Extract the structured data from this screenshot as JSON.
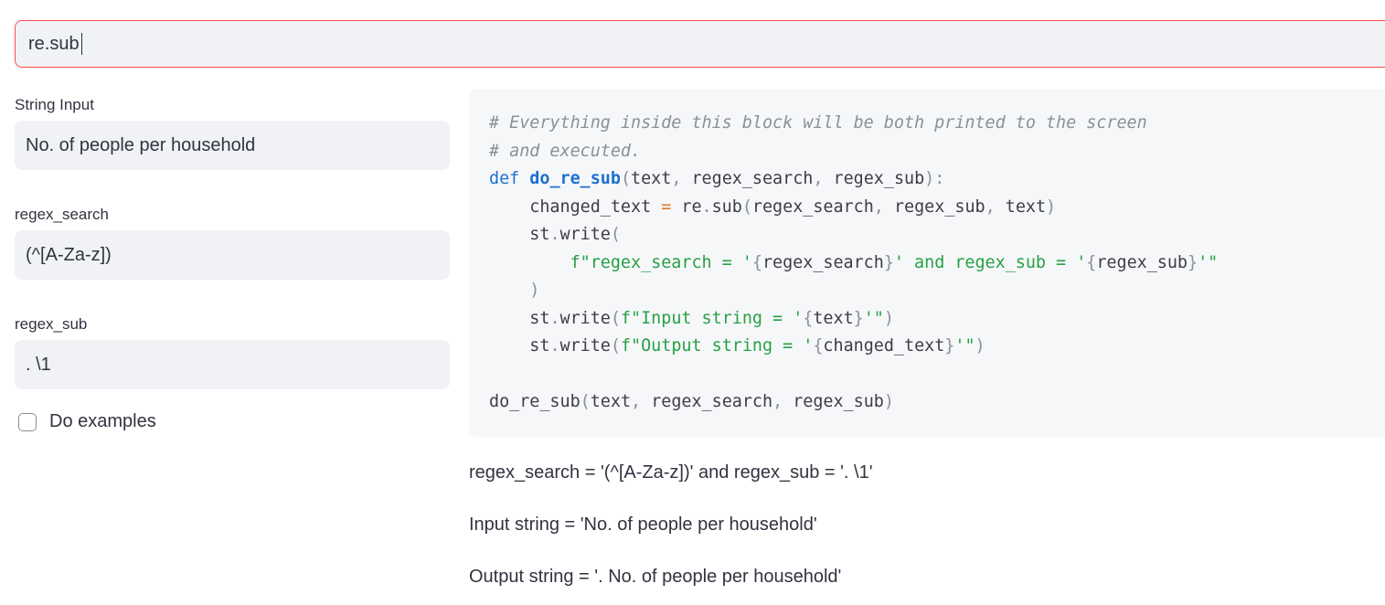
{
  "top_input": {
    "value": "re.sub"
  },
  "fields": [
    {
      "label": "String Input",
      "value": "No. of people per household"
    },
    {
      "label": "regex_search",
      "value": "(^[A-Za-z])"
    },
    {
      "label": "regex_sub",
      "value": ". \\1"
    }
  ],
  "checkbox": {
    "label": "Do examples",
    "checked": false
  },
  "code": {
    "lines": [
      [
        {
          "t": "# Everything inside this block will be both printed to the screen",
          "c": "comment"
        }
      ],
      [
        {
          "t": "# and executed.",
          "c": "comment"
        }
      ],
      [
        {
          "t": "def ",
          "c": "kw"
        },
        {
          "t": "do_re_sub",
          "c": "fn"
        },
        {
          "t": "(",
          "c": "punct"
        },
        {
          "t": "text",
          "c": "plain"
        },
        {
          "t": ", ",
          "c": "punct"
        },
        {
          "t": "regex_search",
          "c": "plain"
        },
        {
          "t": ", ",
          "c": "punct"
        },
        {
          "t": "regex_sub",
          "c": "plain"
        },
        {
          "t": "):",
          "c": "punct"
        }
      ],
      [
        {
          "t": "    changed_text ",
          "c": "plain"
        },
        {
          "t": "=",
          "c": "op"
        },
        {
          "t": " re",
          "c": "plain"
        },
        {
          "t": ".",
          "c": "punct"
        },
        {
          "t": "sub",
          "c": "plain"
        },
        {
          "t": "(",
          "c": "punct"
        },
        {
          "t": "regex_search",
          "c": "plain"
        },
        {
          "t": ", ",
          "c": "punct"
        },
        {
          "t": "regex_sub",
          "c": "plain"
        },
        {
          "t": ", ",
          "c": "punct"
        },
        {
          "t": "text",
          "c": "plain"
        },
        {
          "t": ")",
          "c": "punct"
        }
      ],
      [
        {
          "t": "    st",
          "c": "plain"
        },
        {
          "t": ".",
          "c": "punct"
        },
        {
          "t": "write",
          "c": "plain"
        },
        {
          "t": "(",
          "c": "punct"
        }
      ],
      [
        {
          "t": "        f\"regex_search = '",
          "c": "str"
        },
        {
          "t": "{",
          "c": "punct"
        },
        {
          "t": "regex_search",
          "c": "plain"
        },
        {
          "t": "}",
          "c": "punct"
        },
        {
          "t": "' and regex_sub = '",
          "c": "str"
        },
        {
          "t": "{",
          "c": "punct"
        },
        {
          "t": "regex_sub",
          "c": "plain"
        },
        {
          "t": "}",
          "c": "punct"
        },
        {
          "t": "'\"",
          "c": "str"
        }
      ],
      [
        {
          "t": "    )",
          "c": "punct"
        }
      ],
      [
        {
          "t": "    st",
          "c": "plain"
        },
        {
          "t": ".",
          "c": "punct"
        },
        {
          "t": "write",
          "c": "plain"
        },
        {
          "t": "(",
          "c": "punct"
        },
        {
          "t": "f\"Input string = '",
          "c": "str"
        },
        {
          "t": "{",
          "c": "punct"
        },
        {
          "t": "text",
          "c": "plain"
        },
        {
          "t": "}",
          "c": "punct"
        },
        {
          "t": "'\"",
          "c": "str"
        },
        {
          "t": ")",
          "c": "punct"
        }
      ],
      [
        {
          "t": "    st",
          "c": "plain"
        },
        {
          "t": ".",
          "c": "punct"
        },
        {
          "t": "write",
          "c": "plain"
        },
        {
          "t": "(",
          "c": "punct"
        },
        {
          "t": "f\"Output string = '",
          "c": "str"
        },
        {
          "t": "{",
          "c": "punct"
        },
        {
          "t": "changed_text",
          "c": "plain"
        },
        {
          "t": "}",
          "c": "punct"
        },
        {
          "t": "'\"",
          "c": "str"
        },
        {
          "t": ")",
          "c": "punct"
        }
      ],
      [
        {
          "t": "",
          "c": "plain"
        }
      ],
      [
        {
          "t": "do_re_sub",
          "c": "plain"
        },
        {
          "t": "(",
          "c": "punct"
        },
        {
          "t": "text",
          "c": "plain"
        },
        {
          "t": ", ",
          "c": "punct"
        },
        {
          "t": "regex_search",
          "c": "plain"
        },
        {
          "t": ", ",
          "c": "punct"
        },
        {
          "t": "regex_sub",
          "c": "plain"
        },
        {
          "t": ")",
          "c": "punct"
        }
      ]
    ]
  },
  "outputs": [
    "regex_search = '(^[A-Za-z])' and regex_sub = '. \\1'",
    "Input string = 'No. of people per household'",
    "Output string = '. No. of people per household'"
  ],
  "colors": {
    "accent_error_border": "#ff4b4b",
    "input_bg": "#f0f2f6",
    "code_bg": "#f6f7f9",
    "keyword": "#1d6fd1",
    "string": "#26a143",
    "comment": "#8b8f96",
    "operator": "#e07a2f"
  }
}
